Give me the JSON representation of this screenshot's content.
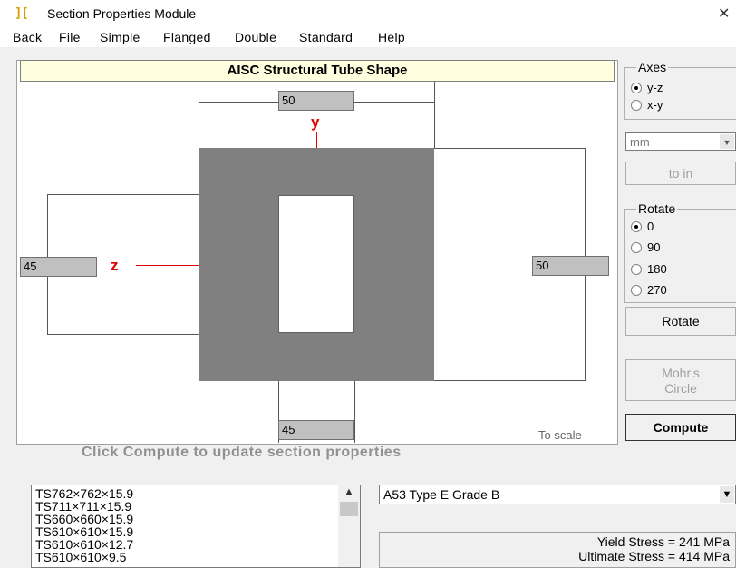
{
  "window": {
    "title": "Section Properties Module",
    "close_glyph": "✕"
  },
  "menu": [
    "Back",
    "File",
    "Simple",
    "Flanged",
    "Double",
    "Standard",
    "Help"
  ],
  "drawing": {
    "header": "AISC Structural Tube Shape",
    "dim_top": "50",
    "dim_bottom": "45",
    "dim_left": "45",
    "dim_right": "50",
    "axis_y": "y",
    "axis_z": "z",
    "to_scale": "To scale"
  },
  "status": "Click Compute to update section properties",
  "axes": {
    "label": "Axes",
    "options": [
      "y-z",
      "x-y"
    ],
    "selected": "y-z"
  },
  "units": {
    "value": "mm",
    "convert_button": "to in"
  },
  "rotate": {
    "label": "Rotate",
    "options": [
      "0",
      "90",
      "180",
      "270"
    ],
    "selected": "0",
    "button": "Rotate"
  },
  "buttons": {
    "mohr": [
      "Mohr's",
      "Circle"
    ],
    "compute": "Compute"
  },
  "shapes": [
    "TS762×762×15.9",
    "TS711×711×15.9",
    "TS660×660×15.9",
    "TS610×610×15.9",
    "TS610×610×12.7",
    "TS610×610×9.5"
  ],
  "material": {
    "value": "A53 Type E Grade B",
    "yield": "Yield Stress = 241 MPa",
    "ultimate": "Ultimate Stress = 414 MPa"
  }
}
